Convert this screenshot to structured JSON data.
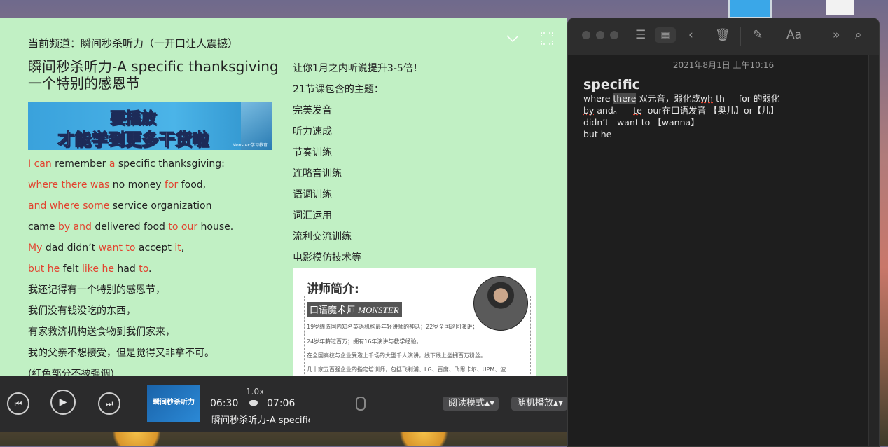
{
  "reader": {
    "channel": "当前频道：瞬间秒杀听力（一开口让人震撼）",
    "title_line1": "瞬间秒杀听力-A specific thanksgiving",
    "title_line2": "一个特别的感恩节",
    "banner": {
      "line1": "要播放",
      "line2": "才能学到更多干货啦",
      "sub": "Monster·学习教育"
    },
    "lines": [
      [
        {
          "t": "I can",
          "r": true
        },
        {
          "t": " remember ",
          "r": false
        },
        {
          "t": "a",
          "r": true
        },
        {
          "t": " specific thanksgiving:",
          "r": false
        }
      ],
      [
        {
          "t": "where there was",
          "r": true
        },
        {
          "t": " no money ",
          "r": false
        },
        {
          "t": "for",
          "r": true
        },
        {
          "t": " food,",
          "r": false
        }
      ],
      [
        {
          "t": "and where some",
          "r": true
        },
        {
          "t": " service organization",
          "r": false
        }
      ],
      [
        {
          "t": "came ",
          "r": false
        },
        {
          "t": "by and",
          "r": true
        },
        {
          "t": " delivered food ",
          "r": false
        },
        {
          "t": "to our",
          "r": true
        },
        {
          "t": " house.",
          "r": false
        }
      ],
      [
        {
          "t": "My",
          "r": true
        },
        {
          "t": " dad didn’t ",
          "r": false
        },
        {
          "t": "want to",
          "r": true
        },
        {
          "t": " accept ",
          "r": false
        },
        {
          "t": "it",
          "r": true
        },
        {
          "t": ",",
          "r": false
        }
      ],
      [
        {
          "t": "but he",
          "r": true
        },
        {
          "t": " felt ",
          "r": false
        },
        {
          "t": "like he",
          "r": true
        },
        {
          "t": " had ",
          "r": false
        },
        {
          "t": "to",
          "r": true
        },
        {
          "t": ".",
          "r": false
        }
      ],
      [
        {
          "t": "我还记得有一个特别的感恩节，",
          "r": false
        }
      ],
      [
        {
          "t": "我们没有钱没吃的东西，",
          "r": false
        }
      ],
      [
        {
          "t": "有家救济机构送食物到我们家来，",
          "r": false
        }
      ],
      [
        {
          "t": "我的父亲不想接受，但是觉得又非拿不可。",
          "r": false
        }
      ],
      [
        {
          "t": "(红色部分不被强调)",
          "r": false
        }
      ]
    ],
    "topics": [
      "让你1月之内听说提升3-5倍！",
      "21节课包含的主题：",
      "完美发音",
      "听力速成",
      "节奏训练",
      "连略音训练",
      "语调训练",
      "词汇运用",
      "流利交流训练",
      "电影模仿技术等"
    ],
    "card": {
      "title": "讲师简介:",
      "tag_cn": "口语魔术师 ",
      "tag_en": "MONSTER",
      "desc": [
        "19岁缔造国内知名英语机构最年轻讲师的神话；22岁全国巡回演讲；",
        "24岁年薪过百万；拥有16年演讲与教学经验。",
        "在全国高校与企业受邀上千场的大型千人演讲，线下线上坐拥百万粉丝。",
        "几十家五百强企业的指定培训师，包括飞利浦、LG、百度、飞思卡尔、UPM、波"
      ]
    }
  },
  "player": {
    "prev_icon": "⏮",
    "play_icon": "▶",
    "next_icon": "⏭",
    "thumb_text": "瞬间秒杀听力",
    "current_time": "06:30",
    "speed": "1.0x",
    "total_time": "07:06",
    "track_title": "瞬间秒杀听力-A specific thanksgiving",
    "read_mode": "阅读模式",
    "random_play": "随机播放"
  },
  "notes": {
    "date": "2021年8月1日 上午10:16",
    "heading": "specific",
    "icons": [
      "list-view-icon",
      "grid-view-icon",
      "back-icon",
      "trash-icon",
      "compose-icon",
      "format-icon",
      "more-icon",
      "search-icon"
    ]
  }
}
